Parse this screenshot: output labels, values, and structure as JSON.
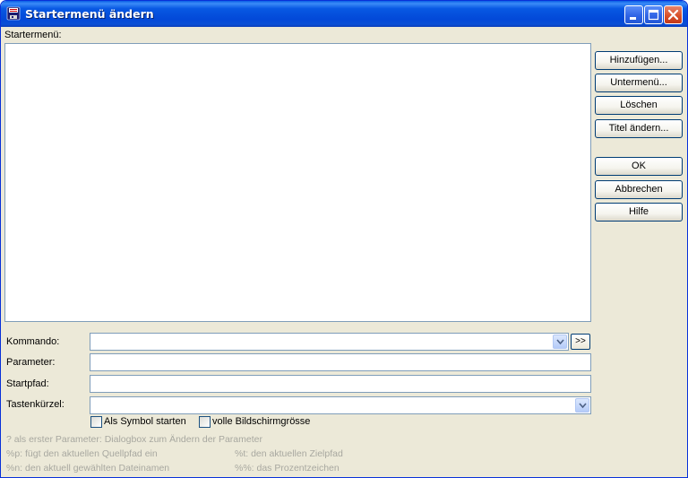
{
  "window": {
    "title": "Startermenü ändern"
  },
  "labels": {
    "startermenu": "Startermenü:",
    "kommando": "Kommando:",
    "parameter": "Parameter:",
    "startpfad": "Startpfad:",
    "tastenkuerzel": "Tastenkürzel:"
  },
  "buttons": {
    "hinzufuegen": "Hinzufügen...",
    "untermenu": "Untermenü...",
    "loeschen": "Löschen",
    "titel_aendern": "Titel ändern...",
    "ok": "OK",
    "abbrechen": "Abbrechen",
    "hilfe": "Hilfe",
    "browse": ">>"
  },
  "fields": {
    "kommando": "",
    "parameter": "",
    "startpfad": "",
    "tastenkuerzel": ""
  },
  "checkboxes": {
    "als_symbol": {
      "label": "Als Symbol starten",
      "checked": false
    },
    "vollbild": {
      "label": "volle Bildschirmgrösse",
      "checked": false
    }
  },
  "hints": {
    "line1": "? als erster Parameter: Dialogbox zum Ändern der Parameter",
    "p": "%p: fügt den aktuellen Quellpfad ein",
    "t": "%t: den aktuellen Zielpfad",
    "n": "%n: den aktuell gewählten Dateinamen",
    "pct": "%%: das Prozentzeichen"
  },
  "icons": {
    "title_icon": "floppy-disk-icon",
    "minimize": "minimize-icon",
    "maximize": "maximize-icon",
    "close": "close-icon",
    "dropdown": "chevron-down-icon"
  }
}
